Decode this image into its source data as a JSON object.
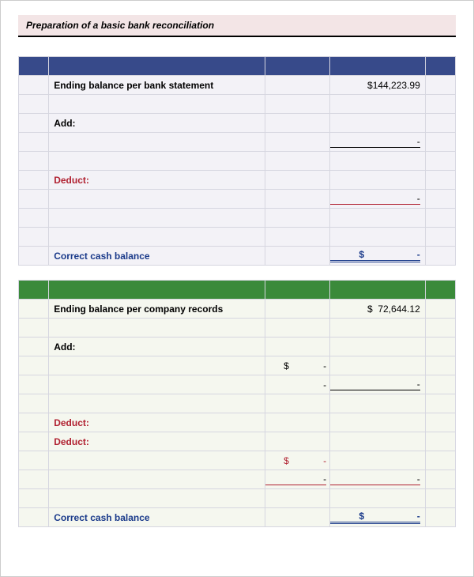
{
  "title": "Preparation of a basic bank reconciliation",
  "bank": {
    "ending_label": "Ending balance per bank statement",
    "ending_value": "$144,223.99",
    "add_label": "Add:",
    "add_value": "-",
    "deduct_label": "Deduct:",
    "deduct_value": "-",
    "correct_label": "Correct cash balance",
    "correct_value": "$                    -"
  },
  "company": {
    "ending_label": "Ending balance per company records",
    "ending_value": "$  72,644.12",
    "add_label": "Add:",
    "add_c3a": "$             -",
    "add_c3b": "-",
    "add_c4": "-",
    "deduct1_label": "Deduct:",
    "deduct2_label": "Deduct:",
    "ded_c3a": "$             -",
    "ded_c3b": "-",
    "ded_c4": "-",
    "correct_label": "Correct cash balance",
    "correct_value": "$                    -"
  }
}
